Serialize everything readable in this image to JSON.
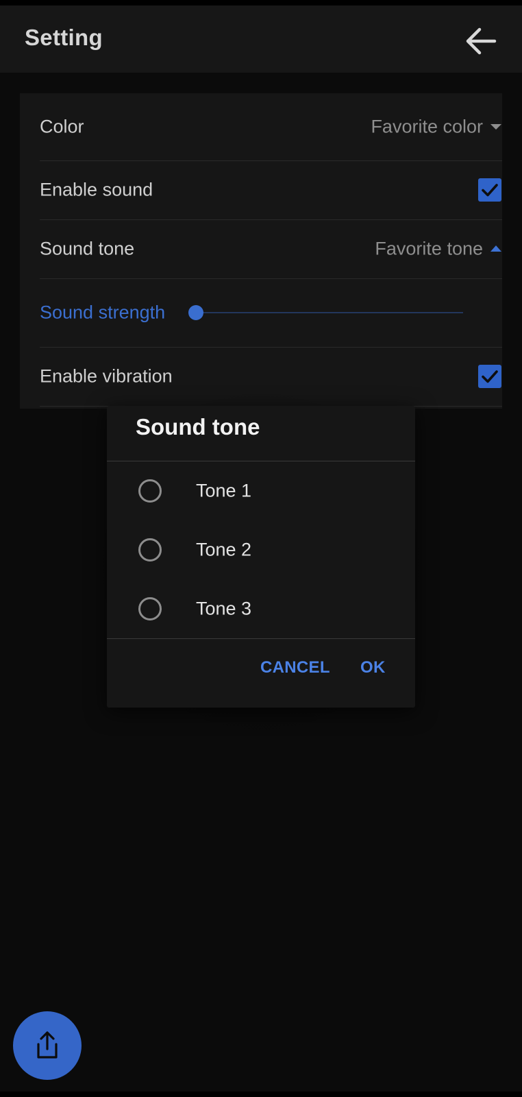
{
  "appbar": {
    "title": "Setting",
    "back_icon": "arrow-left-icon"
  },
  "settings": {
    "color": {
      "label": "Color",
      "value": "Favorite color"
    },
    "enable_sound": {
      "label": "Enable sound",
      "checked": true
    },
    "sound_tone": {
      "label": "Sound tone",
      "value": "Favorite tone"
    },
    "sound_strength": {
      "label": "Sound strength",
      "level": 0
    },
    "enable_vibration": {
      "label": "Enable vibration",
      "checked": true
    }
  },
  "dialog": {
    "title": "Sound tone",
    "options": [
      {
        "label": "Tone 1",
        "selected": false
      },
      {
        "label": "Tone 2",
        "selected": false
      },
      {
        "label": "Tone 3",
        "selected": false
      }
    ],
    "cancel_label": "CANCEL",
    "ok_label": "OK"
  },
  "fab": {
    "icon": "share-icon"
  },
  "colors": {
    "accent": "#3566c8",
    "background": "#0b0b0b",
    "card": "#161616"
  }
}
